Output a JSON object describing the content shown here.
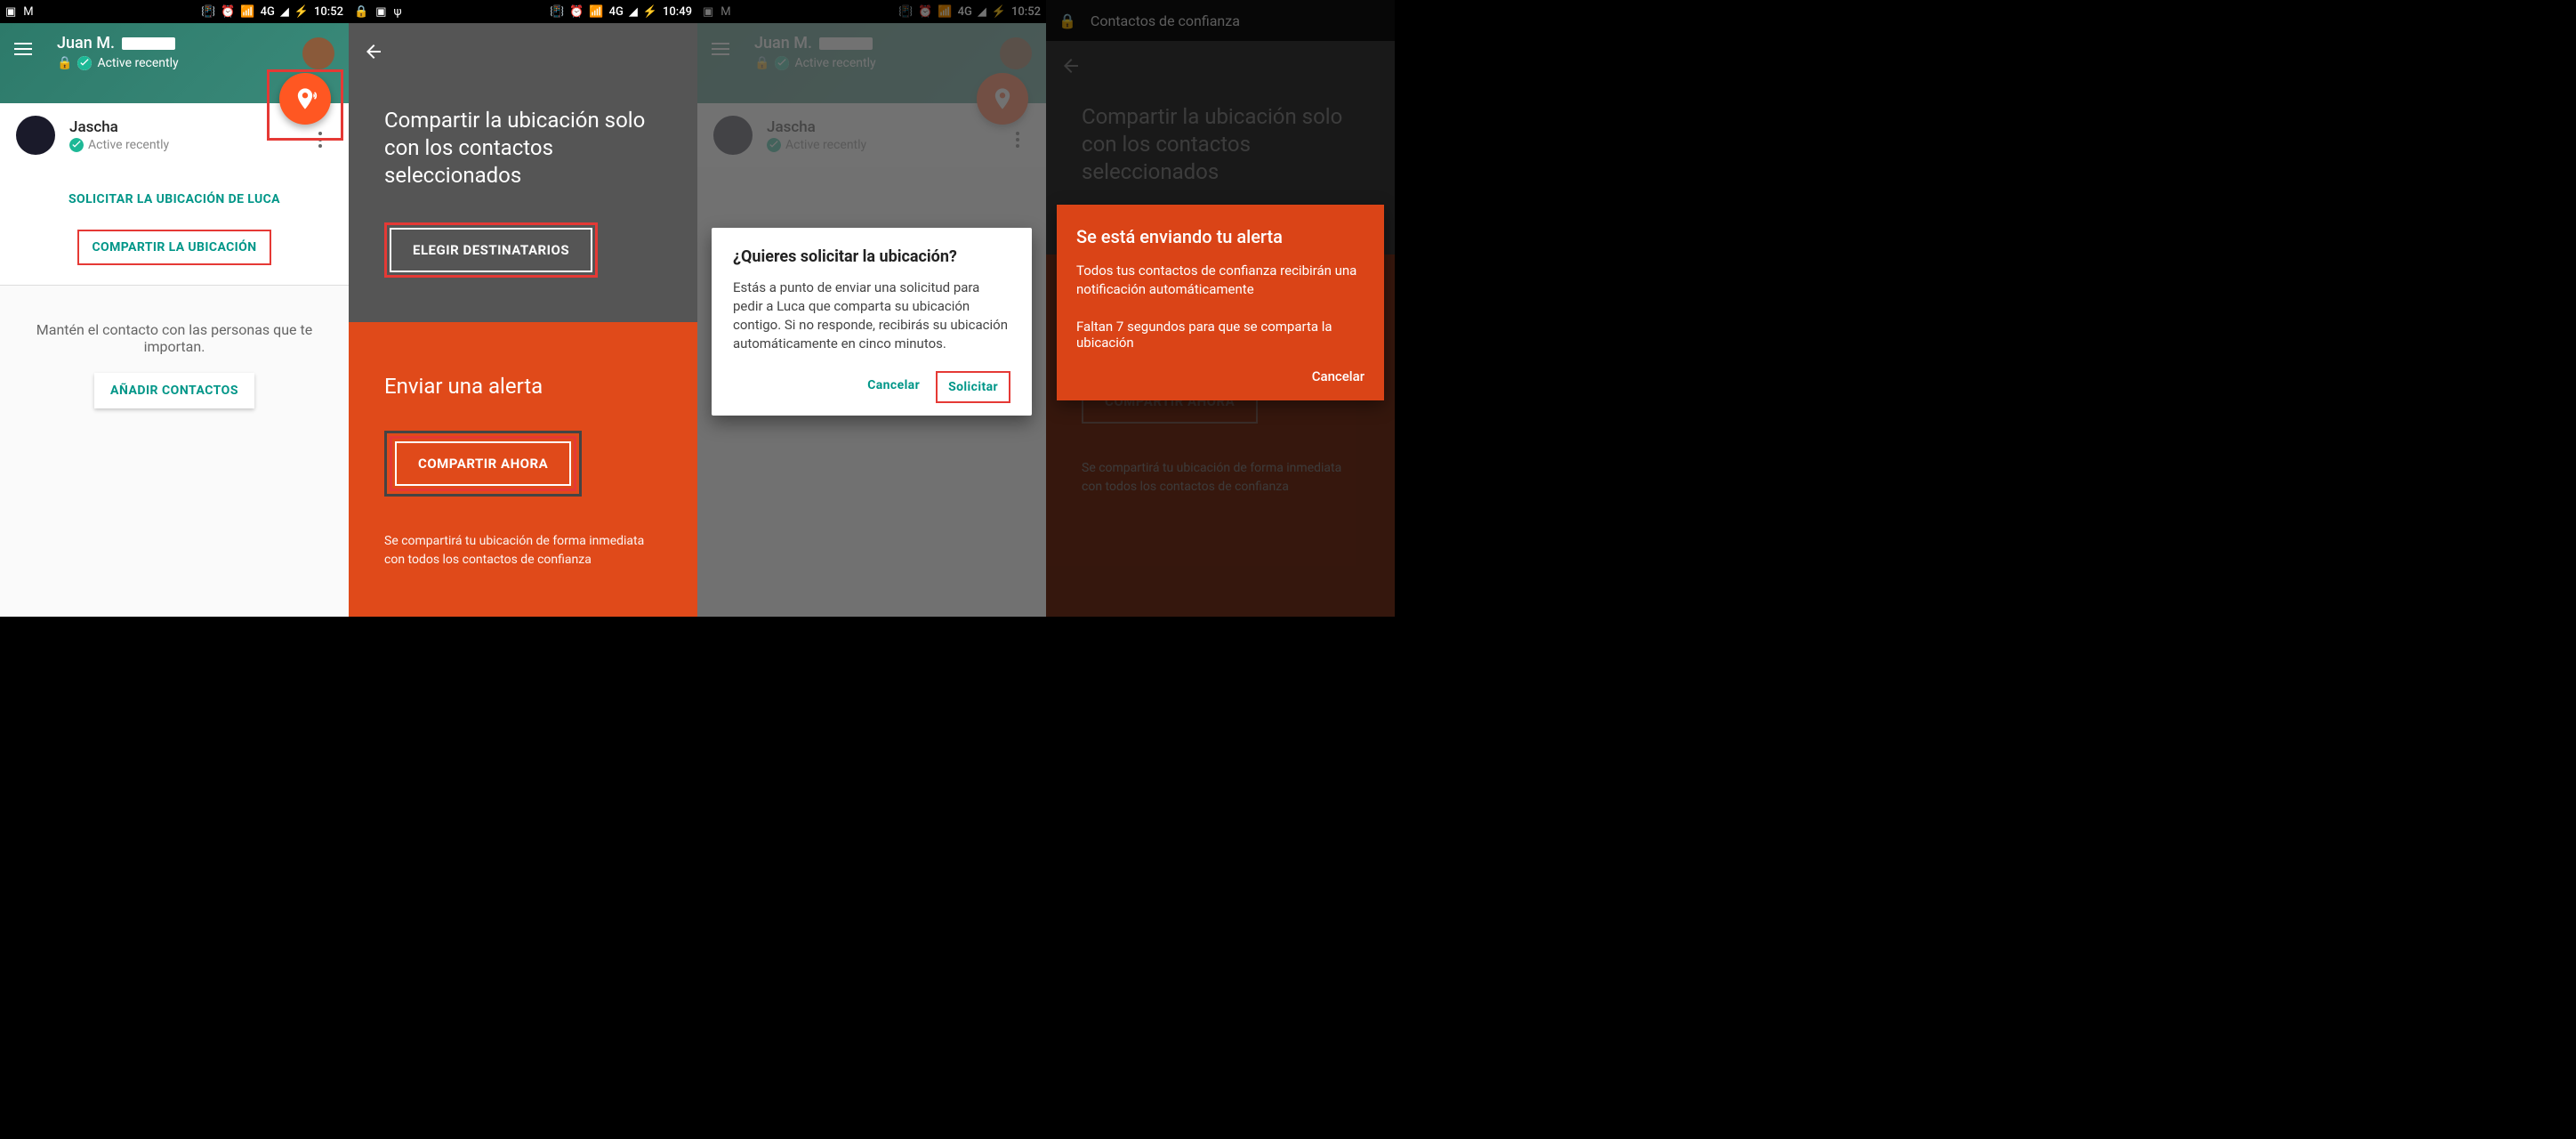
{
  "status": {
    "time1": "10:52",
    "time2": "10:49",
    "sig": "4G"
  },
  "s1": {
    "user": "Juan M.",
    "status": "Active recently",
    "contact": "Jascha",
    "contact_status": "Active recently",
    "request": "SOLICITAR LA UBICACIÓN DE LUCA",
    "share": "COMPARTIR LA UBICACIÓN",
    "keep": "Mantén el contacto con las personas que te importan.",
    "add": "AÑADIR CONTACTOS"
  },
  "s2": {
    "heading": "Compartir la ubicación solo con los contactos seleccionados",
    "choose": "ELEGIR DESTINATARIOS",
    "alert_head": "Enviar una alerta",
    "share_now": "COMPARTIR AHORA",
    "sub": "Se compartirá tu ubicación de forma inmediata con todos los contactos de confianza"
  },
  "s3": {
    "title": "¿Quieres solicitar la ubicación?",
    "body": "Estás a punto de enviar una solicitud para pedir a Luca que comparta su ubicación contigo. Si no responde, recibirás su ubicación automáticamente en cinco minutos.",
    "cancel": "Cancelar",
    "ok": "Solicitar"
  },
  "s4": {
    "appbar": "Contactos de confianza",
    "title": "Se está enviando tu alerta",
    "body": "Todos tus contactos de confianza recibirán una notificación automáticamente",
    "count": "Faltan 7 segundos para que se comparta la ubicación",
    "cancel": "Cancelar"
  }
}
